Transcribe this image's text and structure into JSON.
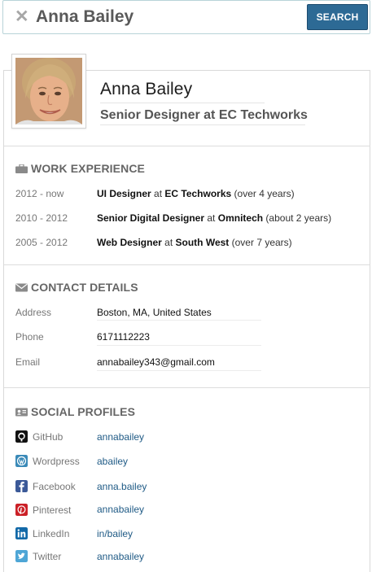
{
  "search": {
    "value": "Anna Bailey",
    "button_label": "SEARCH"
  },
  "profile": {
    "name": "Anna Bailey",
    "title": "Senior Designer at EC Techworks"
  },
  "work_experience": {
    "heading": "WORK EXPERIENCE",
    "items": [
      {
        "period": "2012 - now",
        "role": "UI Designer",
        "at": "at",
        "company": "EC Techworks",
        "duration": "(over 4 years)"
      },
      {
        "period": "2010 - 2012",
        "role": "Senior Digital Designer",
        "at": "at",
        "company": "Omnitech",
        "duration": "(about 2 years)"
      },
      {
        "period": "2005 - 2012",
        "role": "Web Designer",
        "at": "at",
        "company": "South West",
        "duration": "(over 7 years)"
      }
    ]
  },
  "contact": {
    "heading": "CONTACT DETAILS",
    "items": [
      {
        "label": "Address",
        "value": "Boston, MA, United States"
      },
      {
        "label": "Phone",
        "value": "6171112223"
      },
      {
        "label": "Email",
        "value": "annabailey343@gmail.com"
      }
    ]
  },
  "social": {
    "heading": "SOCIAL PROFILES",
    "items": [
      {
        "network": "GitHub",
        "handle": "annabailey",
        "icon": "github-icon",
        "color": "#111111"
      },
      {
        "network": "Wordpress",
        "handle": "abailey",
        "icon": "wordpress-icon",
        "color": "#3a8ab8"
      },
      {
        "network": "Facebook",
        "handle": "anna.bailey",
        "icon": "facebook-icon",
        "color": "#3b5998"
      },
      {
        "network": "Pinterest",
        "handle": "annabailey",
        "icon": "pinterest-icon",
        "color": "#cb2027"
      },
      {
        "network": "LinkedIn",
        "handle": "in/bailey",
        "icon": "linkedin-icon",
        "color": "#1269a8"
      },
      {
        "network": "Twitter",
        "handle": "annabailey",
        "icon": "twitter-icon",
        "color": "#4ea6d6"
      }
    ]
  },
  "colors": {
    "accent": "#2d6a95",
    "link": "#205b86",
    "heading": "#666666"
  }
}
